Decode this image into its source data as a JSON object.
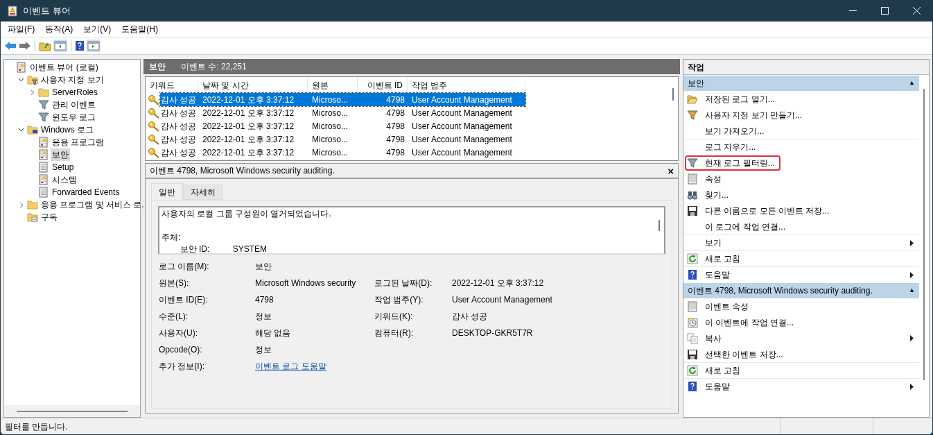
{
  "window": {
    "title": "이벤트 뷰어"
  },
  "menu": [
    "파일(F)",
    "동작(A)",
    "보기(V)",
    "도움말(H)"
  ],
  "tree": [
    {
      "label": "이벤트 뷰어 (로컬)",
      "kind": "log",
      "expandable": false,
      "selected": false,
      "children": [
        {
          "label": "사용자 지정 보기",
          "kind": "folder-filter",
          "expandable": true,
          "expanded": true,
          "selected": false,
          "children": [
            {
              "label": "ServerRoles",
              "kind": "folder",
              "expandable": true,
              "expanded": false,
              "selected": false
            },
            {
              "label": "관리 이벤트",
              "kind": "filter",
              "expandable": false,
              "selected": false
            },
            {
              "label": "윈도우 로그",
              "kind": "filter",
              "expandable": false,
              "selected": false
            }
          ]
        },
        {
          "label": "Windows 로그",
          "kind": "folder-pc",
          "expandable": true,
          "expanded": true,
          "selected": false,
          "children": [
            {
              "label": "응용 프로그램",
              "kind": "log",
              "expandable": false,
              "selected": false
            },
            {
              "label": "보안",
              "kind": "log",
              "expandable": false,
              "selected": true
            },
            {
              "label": "Setup",
              "kind": "page",
              "expandable": false,
              "selected": false
            },
            {
              "label": "시스템",
              "kind": "log",
              "expandable": false,
              "selected": false
            },
            {
              "label": "Forwarded Events",
              "kind": "page",
              "expandable": false,
              "selected": false
            }
          ]
        },
        {
          "label": "응용 프로그램 및 서비스 로.",
          "kind": "folder",
          "expandable": true,
          "expanded": false,
          "selected": false
        },
        {
          "label": "구독",
          "kind": "folder-sub",
          "expandable": false,
          "selected": false
        }
      ]
    }
  ],
  "log_header": {
    "name": "보안",
    "count": "이벤트 수: 22,251"
  },
  "table": {
    "columns": [
      "키워드",
      "날짜 및 시간",
      "원본",
      "이벤트 ID",
      "작업 범주"
    ],
    "rows": [
      {
        "selected": true,
        "cells": [
          "감사 성공",
          "2022-12-01 오후 3:37:12",
          "Microso...",
          "4798",
          "User Account Management"
        ]
      },
      {
        "selected": false,
        "cells": [
          "감사 성공",
          "2022-12-01 오후 3:37:12",
          "Microso...",
          "4798",
          "User Account Management"
        ]
      },
      {
        "selected": false,
        "cells": [
          "감사 성공",
          "2022-12-01 오후 3:37:12",
          "Microso...",
          "4798",
          "User Account Management"
        ]
      },
      {
        "selected": false,
        "cells": [
          "감사 성공",
          "2022-12-01 오후 3:37:12",
          "Microso...",
          "4798",
          "User Account Management"
        ]
      },
      {
        "selected": false,
        "cells": [
          "감사 성공",
          "2022-12-01 오후 3:37:12",
          "Microso...",
          "4798",
          "User Account Management"
        ]
      }
    ]
  },
  "detail": {
    "title": "이벤트 4798, Microsoft Windows security auditing.",
    "close": "×",
    "tabs": [
      {
        "label": "일반",
        "selected": true
      },
      {
        "label": "자세히",
        "selected": false
      }
    ],
    "description": "사용자의 로컬 그룹 구성원이 열거되었습니다.\n\n주체:\n        보안 ID:          SYSTEM",
    "fields": [
      {
        "label": "로그 이름(M):",
        "value": "보안"
      },
      {
        "label": "원본(S):",
        "value": "Microsoft Windows security",
        "label2": "로그된 날짜(D):",
        "value2": "2022-12-01 오후 3:37:12"
      },
      {
        "label": "이벤트 ID(E):",
        "value": "4798",
        "label2": "작업 범주(Y):",
        "value2": "User Account Management"
      },
      {
        "label": "수준(L):",
        "value": "정보",
        "label2": "키워드(K):",
        "value2": "감사 성공"
      },
      {
        "label": "사용자(U):",
        "value": "해당 없음",
        "label2": "컴퓨터(R):",
        "value2": "DESKTOP-GKR5T7R"
      },
      {
        "label": "Opcode(O):",
        "value": "정보"
      },
      {
        "label": "추가 정보(I):",
        "link": "이벤트 로그 도움말"
      }
    ]
  },
  "actions": {
    "title": "작업",
    "sections": [
      {
        "title": "보안",
        "collapse": "▲",
        "items": [
          {
            "label": "저장된 로그 열기...",
            "kind": "folder-open",
            "submenu": false,
            "highlighted": false,
            "separator_before": false
          },
          {
            "label": "사용자 지정 보기 만들기...",
            "kind": "filter-color",
            "submenu": false,
            "highlighted": false,
            "separator_before": false
          },
          {
            "label": "보기 가져오기...",
            "kind": "plain",
            "submenu": false,
            "highlighted": false,
            "separator_before": false
          },
          {
            "label": "로그 지우기...",
            "kind": "plain",
            "submenu": false,
            "highlighted": false,
            "separator_before": true
          },
          {
            "label": "현재 로그 필터링...",
            "kind": "filter",
            "submenu": false,
            "highlighted": true,
            "separator_before": false
          },
          {
            "label": "속성",
            "kind": "properties",
            "submenu": false,
            "highlighted": false,
            "separator_before": false
          },
          {
            "label": "찾기...",
            "kind": "binoculars",
            "submenu": false,
            "highlighted": false,
            "separator_before": false
          },
          {
            "label": "다른 이름으로 모든 이벤트 저장...",
            "kind": "disk",
            "submenu": false,
            "highlighted": false,
            "separator_before": false
          },
          {
            "label": "이 로그에 작업 연결...",
            "kind": "plain",
            "submenu": false,
            "highlighted": false,
            "separator_before": false
          },
          {
            "label": "보기",
            "kind": "plain",
            "submenu": true,
            "highlighted": false,
            "separator_before": true
          },
          {
            "label": "새로 고침",
            "kind": "refresh",
            "submenu": false,
            "highlighted": false,
            "separator_before": true
          },
          {
            "label": "도움말",
            "kind": "help",
            "submenu": true,
            "highlighted": false,
            "separator_before": true
          }
        ]
      },
      {
        "title": "이벤트 4798, Microsoft Windows security auditing.",
        "collapse": "▲",
        "items": [
          {
            "label": "이벤트 속성",
            "kind": "properties",
            "submenu": false,
            "highlighted": false,
            "separator_before": false
          },
          {
            "label": "이 이벤트에 작업 연결...",
            "kind": "clock",
            "submenu": false,
            "highlighted": false,
            "separator_before": false
          },
          {
            "label": "복사",
            "kind": "copy",
            "submenu": true,
            "highlighted": false,
            "separator_before": false
          },
          {
            "label": "선택한 이벤트 저장...",
            "kind": "disk",
            "submenu": false,
            "highlighted": false,
            "separator_before": false
          },
          {
            "label": "새로 고침",
            "kind": "refresh",
            "submenu": false,
            "highlighted": false,
            "separator_before": true
          },
          {
            "label": "도움말",
            "kind": "help",
            "submenu": true,
            "highlighted": false,
            "separator_before": true
          }
        ]
      }
    ]
  },
  "status_bar": {
    "text": "필터를 만듭니다."
  }
}
